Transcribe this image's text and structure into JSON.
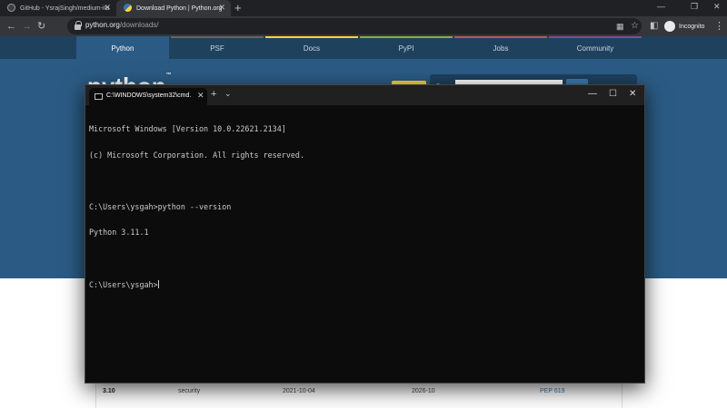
{
  "browser": {
    "tabs": [
      {
        "title": "GitHub - YsrajSingh/medium-ita",
        "close": "✕"
      },
      {
        "title": "Download Python | Python.org",
        "close": "✕"
      }
    ],
    "new_tab": "+",
    "url_domain": "python.org",
    "url_path": "/downloads/",
    "profile_label": "Incognito",
    "icons": [
      "back-arrow-icon",
      "forward-arrow-icon",
      "reload-icon",
      "lock-icon",
      "qr-icon",
      "star-icon",
      "sidebar-icon",
      "menu-icon"
    ]
  },
  "site": {
    "nav": [
      "Python",
      "PSF",
      "Docs",
      "PyPI",
      "Jobs",
      "Community"
    ],
    "nav_colors": [
      "#2b5b84",
      "#646565",
      "#ffd343",
      "#82b043",
      "#b55863",
      "#7d4f92"
    ],
    "logo_text": "python",
    "logo_tm": "™",
    "release_row": {
      "version": "3.10",
      "status": "security",
      "first_released": "2021-10-04",
      "end_of_support": "2026-10",
      "pep": "PEP 619"
    }
  },
  "terminal": {
    "tab_title": "C:\\WINDOWS\\system32\\cmd.",
    "tab_close": "✕",
    "new_tab": "+",
    "dropdown": "⌄",
    "lines": [
      "Microsoft Windows [Version 10.0.22621.2134]",
      "(c) Microsoft Corporation. All rights reserved.",
      "",
      "C:\\Users\\ysgah>python --version",
      "Python 3.11.1",
      "",
      "C:\\Users\\ysgah>"
    ]
  }
}
